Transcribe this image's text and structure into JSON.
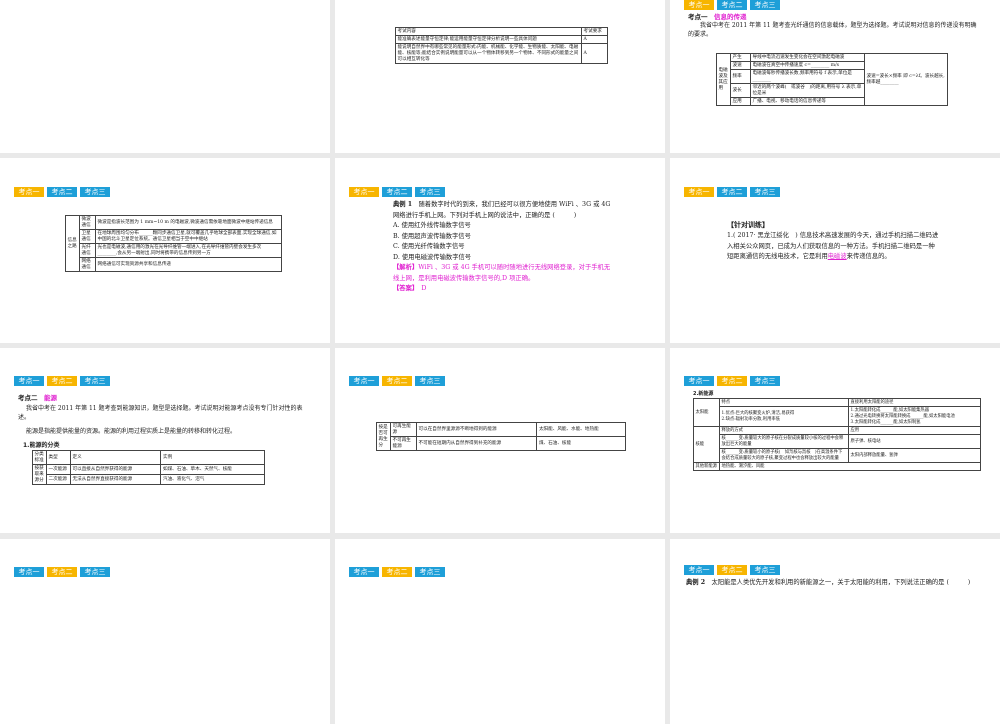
{
  "tags": [
    "考点一",
    "考点二",
    "考点三"
  ],
  "colors": {
    "tag": "#29abe2",
    "tag_active": "#f7b500",
    "highlight": "#e020d0"
  },
  "s2": {
    "h": [
      "考试内容",
      "考试要求"
    ],
    "rows": [
      [
        "能准确表述能量守恒定律;能运用能量守恒定律分析说明一些具体问题",
        "A"
      ],
      [
        "能说明自然界中有哪些常见的能量形式:内能、机械能、化学能、生物质能、太阳能、电磁能、核能等;能结合实例说明能量可以从一个物体转移到另一个物体、不同形式的能量之间可以相互转化等",
        "A"
      ]
    ]
  },
  "s3": {
    "label": "考点一",
    "title": "信息的传递",
    "para": "我省中考在 2011 年第 11 题考查光纤通信的信息载体，题型为选择题。考试说明对信息的传递没有明确的要求。",
    "group": "电磁波及其应用",
    "rows": [
      [
        "产生",
        "导线中电流迅速发生变化会在空间激起电磁波"
      ],
      [
        "波速",
        "电磁波在真空中传播速度 c=________ m/s"
      ],
      [
        "频率",
        "电磁波每秒传播波长数,频率用符号 f 表示,单位是________"
      ],
      [
        "波长",
        "邻近的两个波峰(　或波谷　)的距离,用符号 λ 表示,单位是米"
      ],
      [
        "应用",
        "广播、电视、移动电话的信息传递等"
      ]
    ],
    "side": "波速=波长×频率 即 c=λf。波长越长,频率越________"
  },
  "s4": {
    "group": "信息之路",
    "rows": [
      [
        "微波通信",
        "微波是指波长范围为 1 mm~10 m 的电磁波,微波通信需依靠地面微波中继站传递信息"
      ],
      [
        "卫星通信",
        "在地球周围均匀分布______颗同步通信卫星,就可覆盖几乎地球全部表面,实现全球通信,如中国的北斗卫星定位系统。通信卫星相当于空中中继站"
      ],
      [
        "光纤通信",
        "光也是电磁波,通信用的激光在光导纤维管一端进入,在光导纤维管内壁会发生多次________,会从另一端射出,同时将携带的信息传到另一方"
      ],
      [
        "网络通信",
        "网络通信可实现资源共享和信息传递"
      ]
    ]
  },
  "s5": {
    "label": "典例 1",
    "q": "随着数字时代的到来，我们已经可以很方便地使用 WiFi 、3G 或 4G 网络进行手机上网。下列对手机上网的说法中，正确的是 (　　　)",
    "opts": [
      "A. 使用红外线传输数字信号",
      "B. 使用超声波传输数字信号",
      "C. 使用光纤传输数字信号",
      "D. 使用电磁波传输数字信号"
    ],
    "jx_label": "【解析】",
    "jx": "WiFi 、3G 或 4G 手机可以随时随地进行无线网络登录，对于手机无线上网，是利用电磁波传输数字信号的,D 项正确。",
    "da_label": "【答案】",
    "da": "D"
  },
  "s6": {
    "title": "【针对训练】",
    "text": "1.( 2017· 黑龙江绥化　) 信息技术高速发展的今天，通过手机扫描二维码进入相关公众网页，已成为人们获取信息的一种方法。手机扫描二维码是一种短距离通信的无线电技术，它是利用",
    "ans": "电磁波",
    "tail": "来传递信息的。"
  },
  "s7": {
    "label": "考点二",
    "title": "能源",
    "para1": "我省中考在 2011 年第 11 题考查到能源知识，题型是选择题。考试说明对能源考点没有专门针对性的表述。",
    "para2": "能源是指能提供能量的资源。能源的利用过程实质上是能量的转移和转化过程。",
    "sub": "1.能源的分类",
    "h": [
      "分类标准",
      "类型",
      "定义",
      "实例"
    ],
    "group": "按获取来源分",
    "rows": [
      [
        "一次能源",
        "可以直接从自然界获得的能源",
        "如煤、石油、草木、天然气、核能"
      ],
      [
        "二次能源",
        "无法从自然界直接获得的能源",
        "汽油、液化气、沼气"
      ]
    ]
  },
  "s8": {
    "group": "按是否可再生分",
    "rows": [
      [
        "可再生能源",
        "可以在自然界里源源不断地得到的能源",
        "太阳能、风能、水能、地热能"
      ],
      [
        "不可再生能源",
        "不可能在短期内从自然界得到补充的能源",
        "煤、石油、核能"
      ]
    ]
  },
  "s9": {
    "sub": "2.新能源",
    "solar": "太阳能",
    "solar_h": [
      "特点",
      "直接利用太阳能的途径"
    ],
    "solar_a": [
      "1.优点:巨大的核聚变火炉,清洁,易获得",
      "2.缺点:辐射功率分散,利用率低"
    ],
    "solar_b": [
      "1.太阳能转化成______能,如太阳能集热器",
      "2.通过光电转换将太阳能转换成______能,如太阳能电池",
      "3.太阳能转化成______能,如太阳制氢"
    ],
    "nuclear": "核能",
    "nuc_h": [
      "释放的方式",
      "应用"
    ],
    "nuc_rows": [
      [
        "核______变:质量较大的原子核在分裂成质量较小核的过程中会释放出巨大的能量",
        "原子弹、核电站"
      ],
      [
        "核______变:质量较小的原子核(　如氘核与氚核　)在高温条件下会结合成质量较大的原子核,聚变过程中也会释放出较大的能量",
        "太阳内部释放能量、氢弹"
      ]
    ],
    "other": "其他新能源",
    "other_v": "地热能、潮汐能、风能"
  },
  "s12": {
    "label": "典例 2",
    "q": "太阳能是人类优先开发和利用的新能源之一，关于太阳能的利用，下列说法正确的是 (　　　)"
  }
}
